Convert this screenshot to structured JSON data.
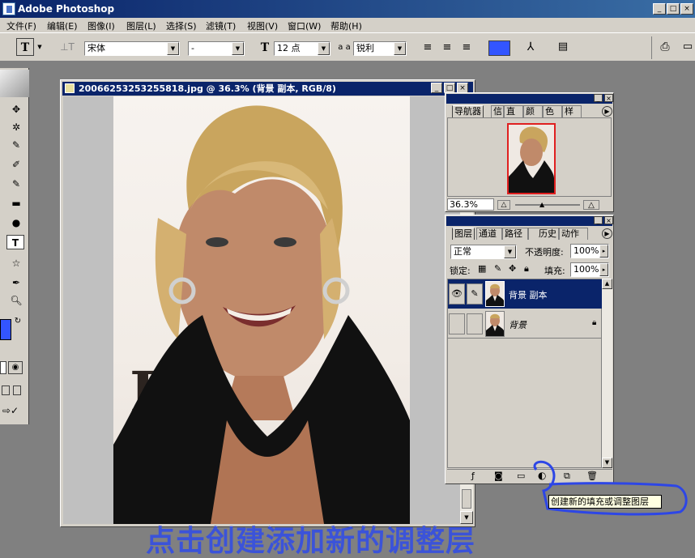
{
  "app": {
    "title": "Adobe Photoshop"
  },
  "window_buttons": {
    "minimize": "_",
    "maximize": "□",
    "close": "×"
  },
  "menu": [
    "文件(F)",
    "编辑(E)",
    "图像(I)",
    "图层(L)",
    "选择(S)",
    "滤镜(T)",
    "视图(V)",
    "窗口(W)",
    "帮助(H)"
  ],
  "options": {
    "tool_glyph": "T",
    "font_family": "宋体",
    "font_style": "-",
    "size_glyph": "T",
    "font_size": "12 点",
    "aa_glyph": "a a",
    "antialias": "锐利",
    "color_swatch": "#3355ff"
  },
  "document": {
    "title": "20066253253255818.jpg @ 36.3% (背景 副本, RGB/8)",
    "photo_text": "B"
  },
  "navigator": {
    "tabs": [
      "导航器",
      "信息",
      "直方图",
      "颜色",
      "色板",
      "样式"
    ],
    "zoom": "36.3%"
  },
  "layers": {
    "tabs": [
      "图层",
      "通道",
      "路径",
      "历史记录",
      "动作"
    ],
    "blend_mode": "正常",
    "opacity_label": "不透明度:",
    "opacity": "100%",
    "lock_label": "锁定:",
    "fill_label": "填充:",
    "fill": "100%",
    "items": [
      {
        "name": "背景 副本",
        "selected": true
      },
      {
        "name": "背景",
        "selected": false
      }
    ]
  },
  "tooltip": "创建新的填充或调整图层",
  "caption": "点击创建添加新的调整层",
  "colors": {
    "title_blue": "#0a246a",
    "selection": "#0a246a",
    "annotation": "#2d46e6",
    "foreground": "#3355ff"
  }
}
